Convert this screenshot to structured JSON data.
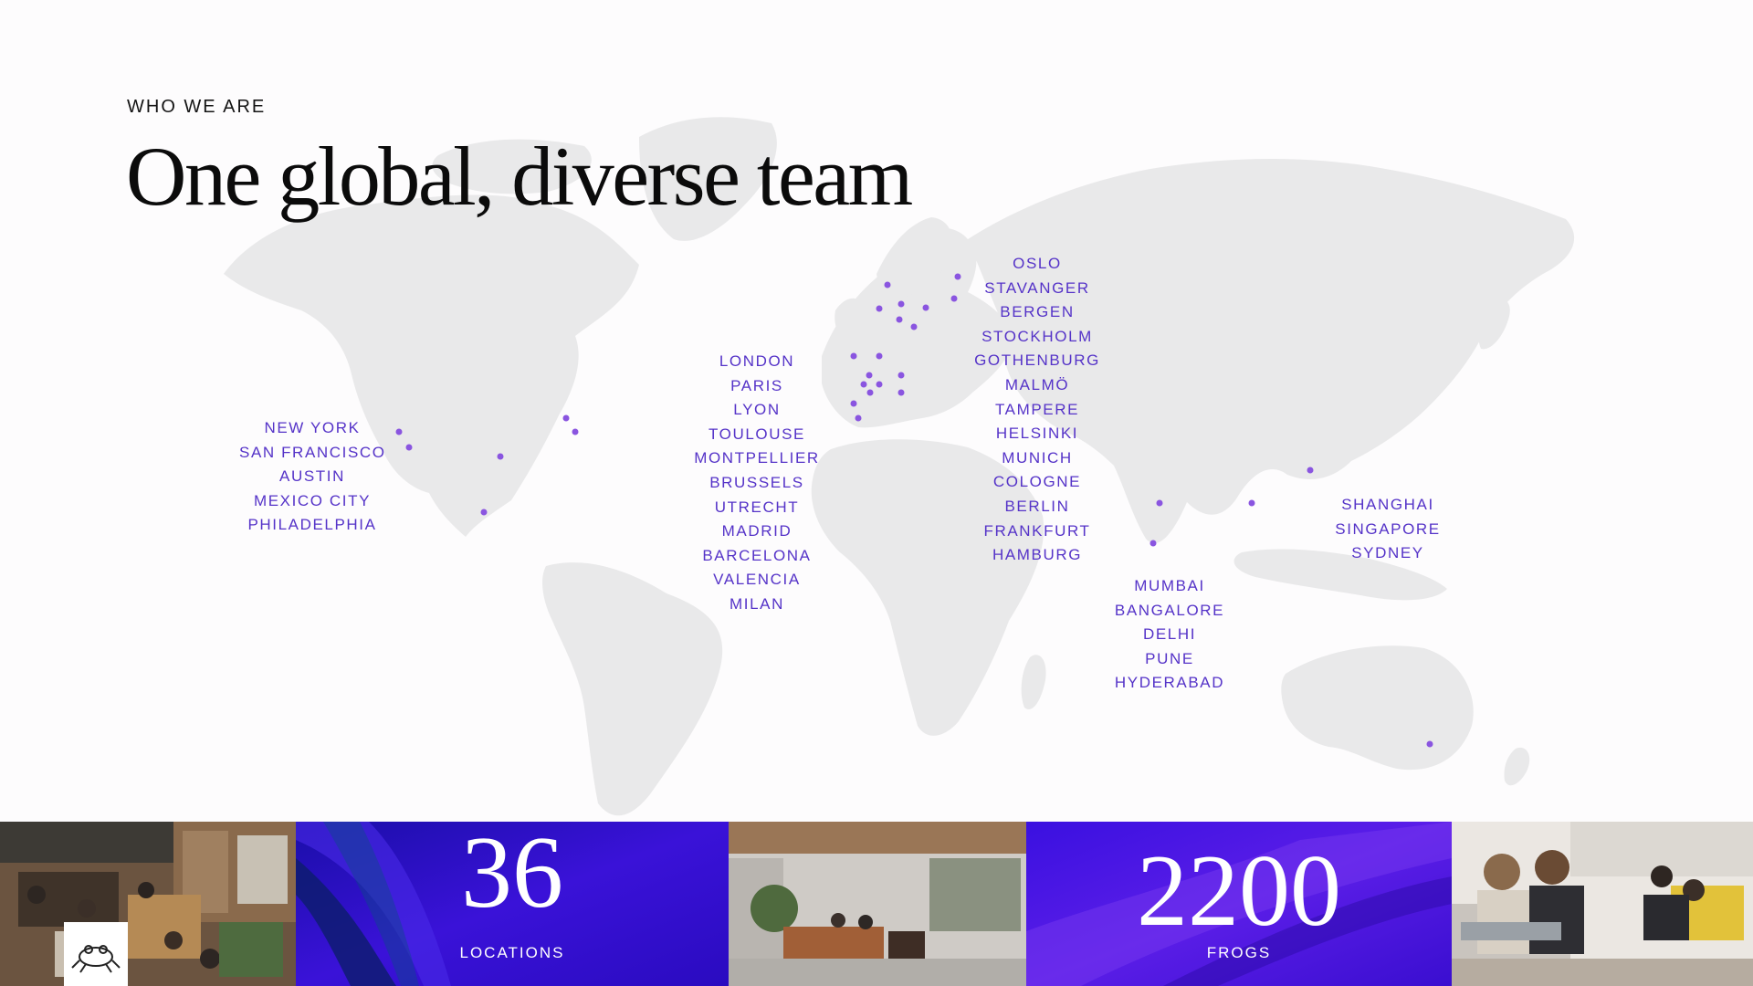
{
  "header": {
    "eyebrow": "WHO WE ARE",
    "title": "One global, diverse team"
  },
  "cities": {
    "americas": [
      "NEW YORK",
      "SAN FRANCISCO",
      "AUSTIN",
      "MEXICO CITY",
      "PHILADELPHIA"
    ],
    "west_europe": [
      "LONDON",
      "PARIS",
      "LYON",
      "TOULOUSE",
      "MONTPELLIER",
      "BRUSSELS",
      "UTRECHT",
      "MADRID",
      "BARCELONA",
      "VALENCIA",
      "MILAN"
    ],
    "north_europe": [
      "OSLO",
      "STAVANGER",
      "BERGEN",
      "STOCKHOLM",
      "GOTHENBURG",
      "MALMÖ",
      "TAMPERE",
      "HELSINKI",
      "MUNICH",
      "COLOGNE",
      "BERLIN",
      "FRANKFURT",
      "HAMBURG"
    ],
    "india": [
      "MUMBAI",
      "BANGALORE",
      "DELHI",
      "PUNE",
      "HYDERABAD"
    ],
    "asia_pacific": [
      "SHANGHAI",
      "SINGAPORE",
      "SYDNEY"
    ]
  },
  "stats": {
    "locations": {
      "value": "36",
      "label": "LOCATIONS"
    },
    "frogs": {
      "value": "2200",
      "label": "FROGS"
    }
  },
  "colors": {
    "accent": "#5533c8",
    "dot": "#8a55e0",
    "map_land": "#e9e9ea",
    "stat_panel": "#3a12d8"
  },
  "icons": {
    "logo": "frog-logo-icon",
    "marker": "location-dot-icon"
  }
}
